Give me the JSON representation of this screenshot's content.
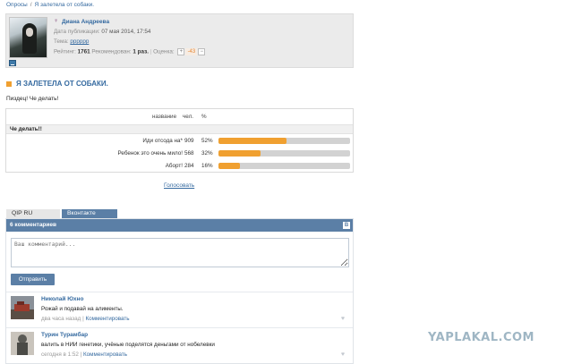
{
  "breadcrumb": {
    "items": [
      "Опросы",
      "Я залетела от собаки."
    ],
    "separator": "/"
  },
  "author": {
    "name": "Диана Андреева",
    "published_label": "Дата публикации:",
    "published_value": "07 мая 2014, 17:54",
    "topic_label": "Тема:",
    "topic_value": "рррррр",
    "rating_label": "Рейтинг:",
    "rating_value": "1761",
    "recommended_label": "Рекомендован:",
    "recommended_value": "1 раз.",
    "score_label": "Оценка:",
    "score_plus": "+",
    "score_value": "-43",
    "score_minus": "−"
  },
  "post": {
    "title": "Я ЗАЛЕТЕЛА ОТ СОБАКИ.",
    "text": "Пиздец! Че делать!"
  },
  "poll": {
    "header_name": "название",
    "header_count": "чел.",
    "header_pct": "%",
    "question": "Че делать!!",
    "options": [
      {
        "label": "Иди отсода на*",
        "count": "909",
        "percent_text": "52%",
        "percent": 52
      },
      {
        "label": "Ребенок это очень мило!",
        "count": "568",
        "percent_text": "32%",
        "percent": 32
      },
      {
        "label": "Аборт!",
        "count": "284",
        "percent_text": "16%",
        "percent": 16
      }
    ],
    "vote_link": "Голосовать"
  },
  "tabs": {
    "qip": "QIP RU",
    "vk": "Вконтакте"
  },
  "vk": {
    "comments_count": "6 комментариев",
    "logo": "В",
    "input_placeholder": "Ваш комментарий...",
    "send_label": "Отправить",
    "comments": [
      {
        "name": "Николай Юхно",
        "text": "Рожай и подавай на алименты.",
        "time": "два часа назад",
        "separator": "|",
        "reply": "Комментировать"
      },
      {
        "name": "Турин Турамбар",
        "text": "валить в НИИ генетики, учёные поделятся деньгами от нобелевки",
        "time": "сегодня в 1:52",
        "separator": "|",
        "reply": "Комментировать"
      }
    ]
  },
  "watermark": "YAPLAKAL.COM",
  "colors": {
    "link": "#356aa0",
    "accent": "#f0a030",
    "vk_blue": "#5b7fa6"
  }
}
